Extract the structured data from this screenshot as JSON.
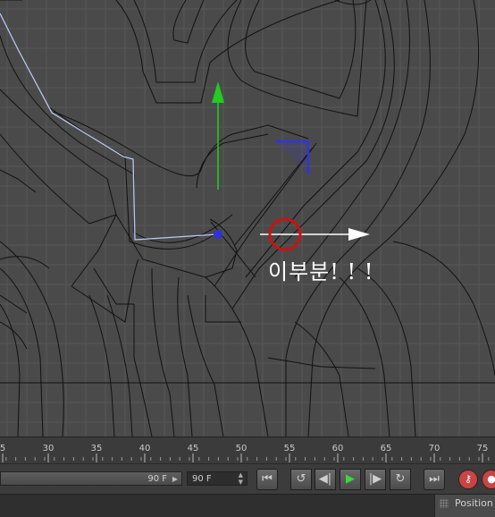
{
  "viewport": {
    "annotation_text": "이부분! ! !",
    "colors": {
      "background": "#4a4a4a",
      "grid": "#585858",
      "wire": "#111111",
      "selected_edge": "#b9c6ee",
      "y_axis": "#22cc22",
      "x_axis": "#ffffff",
      "z_axis": "#3333dd",
      "highlight_circle": "#cc1111"
    },
    "icons": [
      "move-gizmo-y-arrow",
      "move-gizmo-x-arrow",
      "move-gizmo-z-handle",
      "axis-center-dot"
    ]
  },
  "timeline": {
    "ticks": [
      "5",
      "30",
      "35",
      "40",
      "45",
      "50",
      "55",
      "60",
      "65",
      "70",
      "75"
    ]
  },
  "controls": {
    "end_frame": "90 F",
    "fps_field": "90 F",
    "buttons": [
      {
        "name": "go-to-start-button",
        "icon": "skip-back-icon"
      },
      {
        "name": "loop-back-button",
        "icon": "rewind-loop-icon"
      },
      {
        "name": "step-back-button",
        "icon": "step-back-icon"
      },
      {
        "name": "play-button",
        "icon": "play-icon"
      },
      {
        "name": "step-forward-button",
        "icon": "step-forward-icon"
      },
      {
        "name": "loop-forward-button",
        "icon": "forward-loop-icon"
      },
      {
        "name": "go-to-end-button",
        "icon": "skip-forward-icon"
      },
      {
        "name": "record-key-button",
        "icon": "key-icon"
      },
      {
        "name": "auto-key-button",
        "icon": "record-icon"
      }
    ]
  },
  "status": {
    "panel_tab": "Position"
  }
}
